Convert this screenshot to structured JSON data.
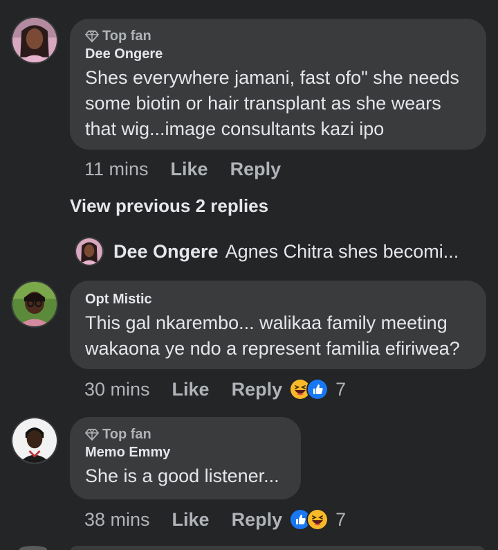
{
  "comments": [
    {
      "badge": "Top fan",
      "author": "Dee Ongere",
      "text": "Shes everywhere jamani, fast ofo\" she needs\nsome biotin or hair transplant as she wears\nthat wig...image consultants kazi ipo",
      "time": "11 mins",
      "like_label": "Like",
      "reply_label": "Reply"
    },
    {
      "author": "Opt Mistic",
      "text": "This gal nkarembo... walikaa family meeting\nwakaona ye ndo a represent familia efiriwea?",
      "time": "30 mins",
      "like_label": "Like",
      "reply_label": "Reply",
      "reaction_count": "7",
      "reactions": [
        "haha-icon",
        "like-icon"
      ]
    },
    {
      "badge": "Top fan",
      "author": "Memo Emmy",
      "text": "She is a good listener...",
      "time": "38 mins",
      "like_label": "Like",
      "reply_label": "Reply",
      "reaction_count": "7",
      "reactions": [
        "like-icon",
        "haha-icon"
      ]
    }
  ],
  "view_previous": "View previous 2 replies",
  "reply_preview": {
    "author": "Dee Ongere",
    "text": "Agnes Chitra shes becomi..."
  },
  "colors": {
    "background": "#242526",
    "bubble": "#3a3b3c",
    "primary_text": "#e4e6eb",
    "secondary_text": "#b0b3b8",
    "like_blue": "#1877f2",
    "haha_yellow": "#f7b928"
  }
}
